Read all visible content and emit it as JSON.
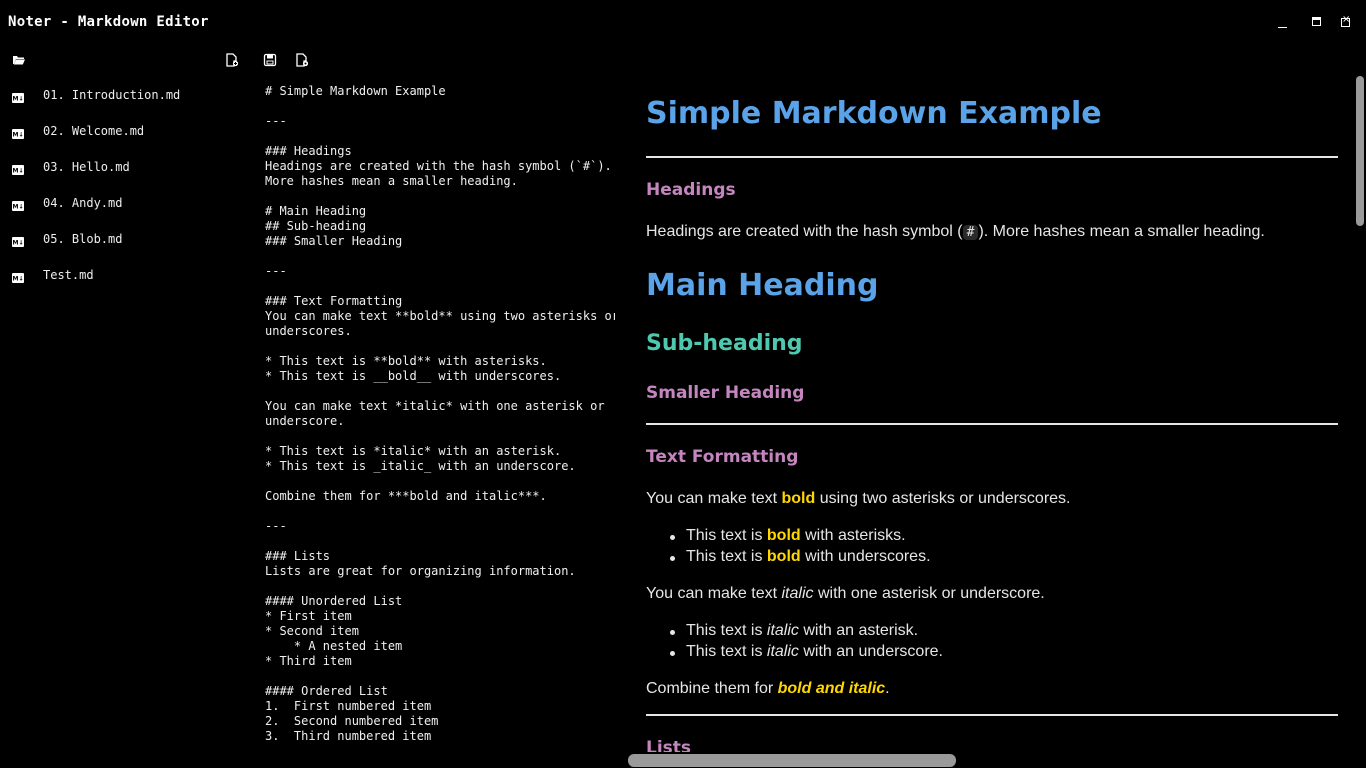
{
  "window": {
    "title": "Noter - Markdown Editor",
    "controls": [
      "minimize",
      "maximize",
      "close"
    ]
  },
  "toolbar": {
    "icons": [
      "open-folder-icon",
      "new-file-icon",
      "save-icon",
      "settings-file-icon"
    ]
  },
  "sidebar": {
    "files": [
      {
        "name": "01. Introduction.md"
      },
      {
        "name": "02. Welcome.md"
      },
      {
        "name": "03. Hello.md"
      },
      {
        "name": "04. Andy.md"
      },
      {
        "name": "05. Blob.md"
      },
      {
        "name": "Test.md"
      }
    ]
  },
  "editor": {
    "lines": [
      "# Simple Markdown Example",
      "",
      "---",
      "",
      "### Headings",
      "Headings are created with the hash symbol (`#`).",
      "More hashes mean a smaller heading.",
      "",
      "# Main Heading",
      "## Sub-heading",
      "### Smaller Heading",
      "",
      "---",
      "",
      "### Text Formatting",
      "You can make text **bold** using two asterisks or",
      "underscores.",
      "",
      "* This text is **bold** with asterisks.",
      "* This text is __bold__ with underscores.",
      "",
      "You can make text *italic* with one asterisk or",
      "underscore.",
      "",
      "* This text is *italic* with an asterisk.",
      "* This text is _italic_ with an underscore.",
      "",
      "Combine them for ***bold and italic***.",
      "",
      "---",
      "",
      "### Lists",
      "Lists are great for organizing information.",
      "",
      "#### Unordered List",
      "* First item",
      "* Second item",
      "    * A nested item",
      "* Third item",
      "",
      "#### Ordered List",
      "1.  First numbered item",
      "2.  Second numbered item",
      "3.  Third numbered item"
    ]
  },
  "preview": {
    "h1_title": "Simple Markdown Example",
    "headings_title": "Headings",
    "headings_p_before": "Headings are created with the hash symbol (",
    "headings_code": "#",
    "headings_p_after": "). More hashes mean a smaller heading.",
    "main_heading": "Main Heading",
    "sub_heading": "Sub-heading",
    "smaller_heading": "Smaller Heading",
    "text_formatting_title": "Text Formatting",
    "tf_p1_a": "You can make text ",
    "tf_p1_bold": "bold",
    "tf_p1_b": " using two asterisks or underscores.",
    "li1_a": "This text is ",
    "li1_bold": "bold",
    "li1_b": " with asterisks.",
    "li2_a": "This text is ",
    "li2_bold": "bold",
    "li2_b": " with underscores.",
    "tf_p2_a": "You can make text ",
    "tf_p2_ital": "italic",
    "tf_p2_b": " with one asterisk or underscore.",
    "li3_a": "This text is ",
    "li3_ital": "italic",
    "li3_b": " with an asterisk.",
    "li4_a": "This text is ",
    "li4_ital": "italic",
    "li4_b": " with an underscore.",
    "combine_a": "Combine them for ",
    "combine_bi": "bold and italic",
    "combine_b": ".",
    "lists_title": "Lists"
  },
  "colors": {
    "background": "#000000",
    "h1": "#5aa3e8",
    "h2": "#4ec9b0",
    "h3": "#c586c0",
    "bold": "#ffd700"
  }
}
